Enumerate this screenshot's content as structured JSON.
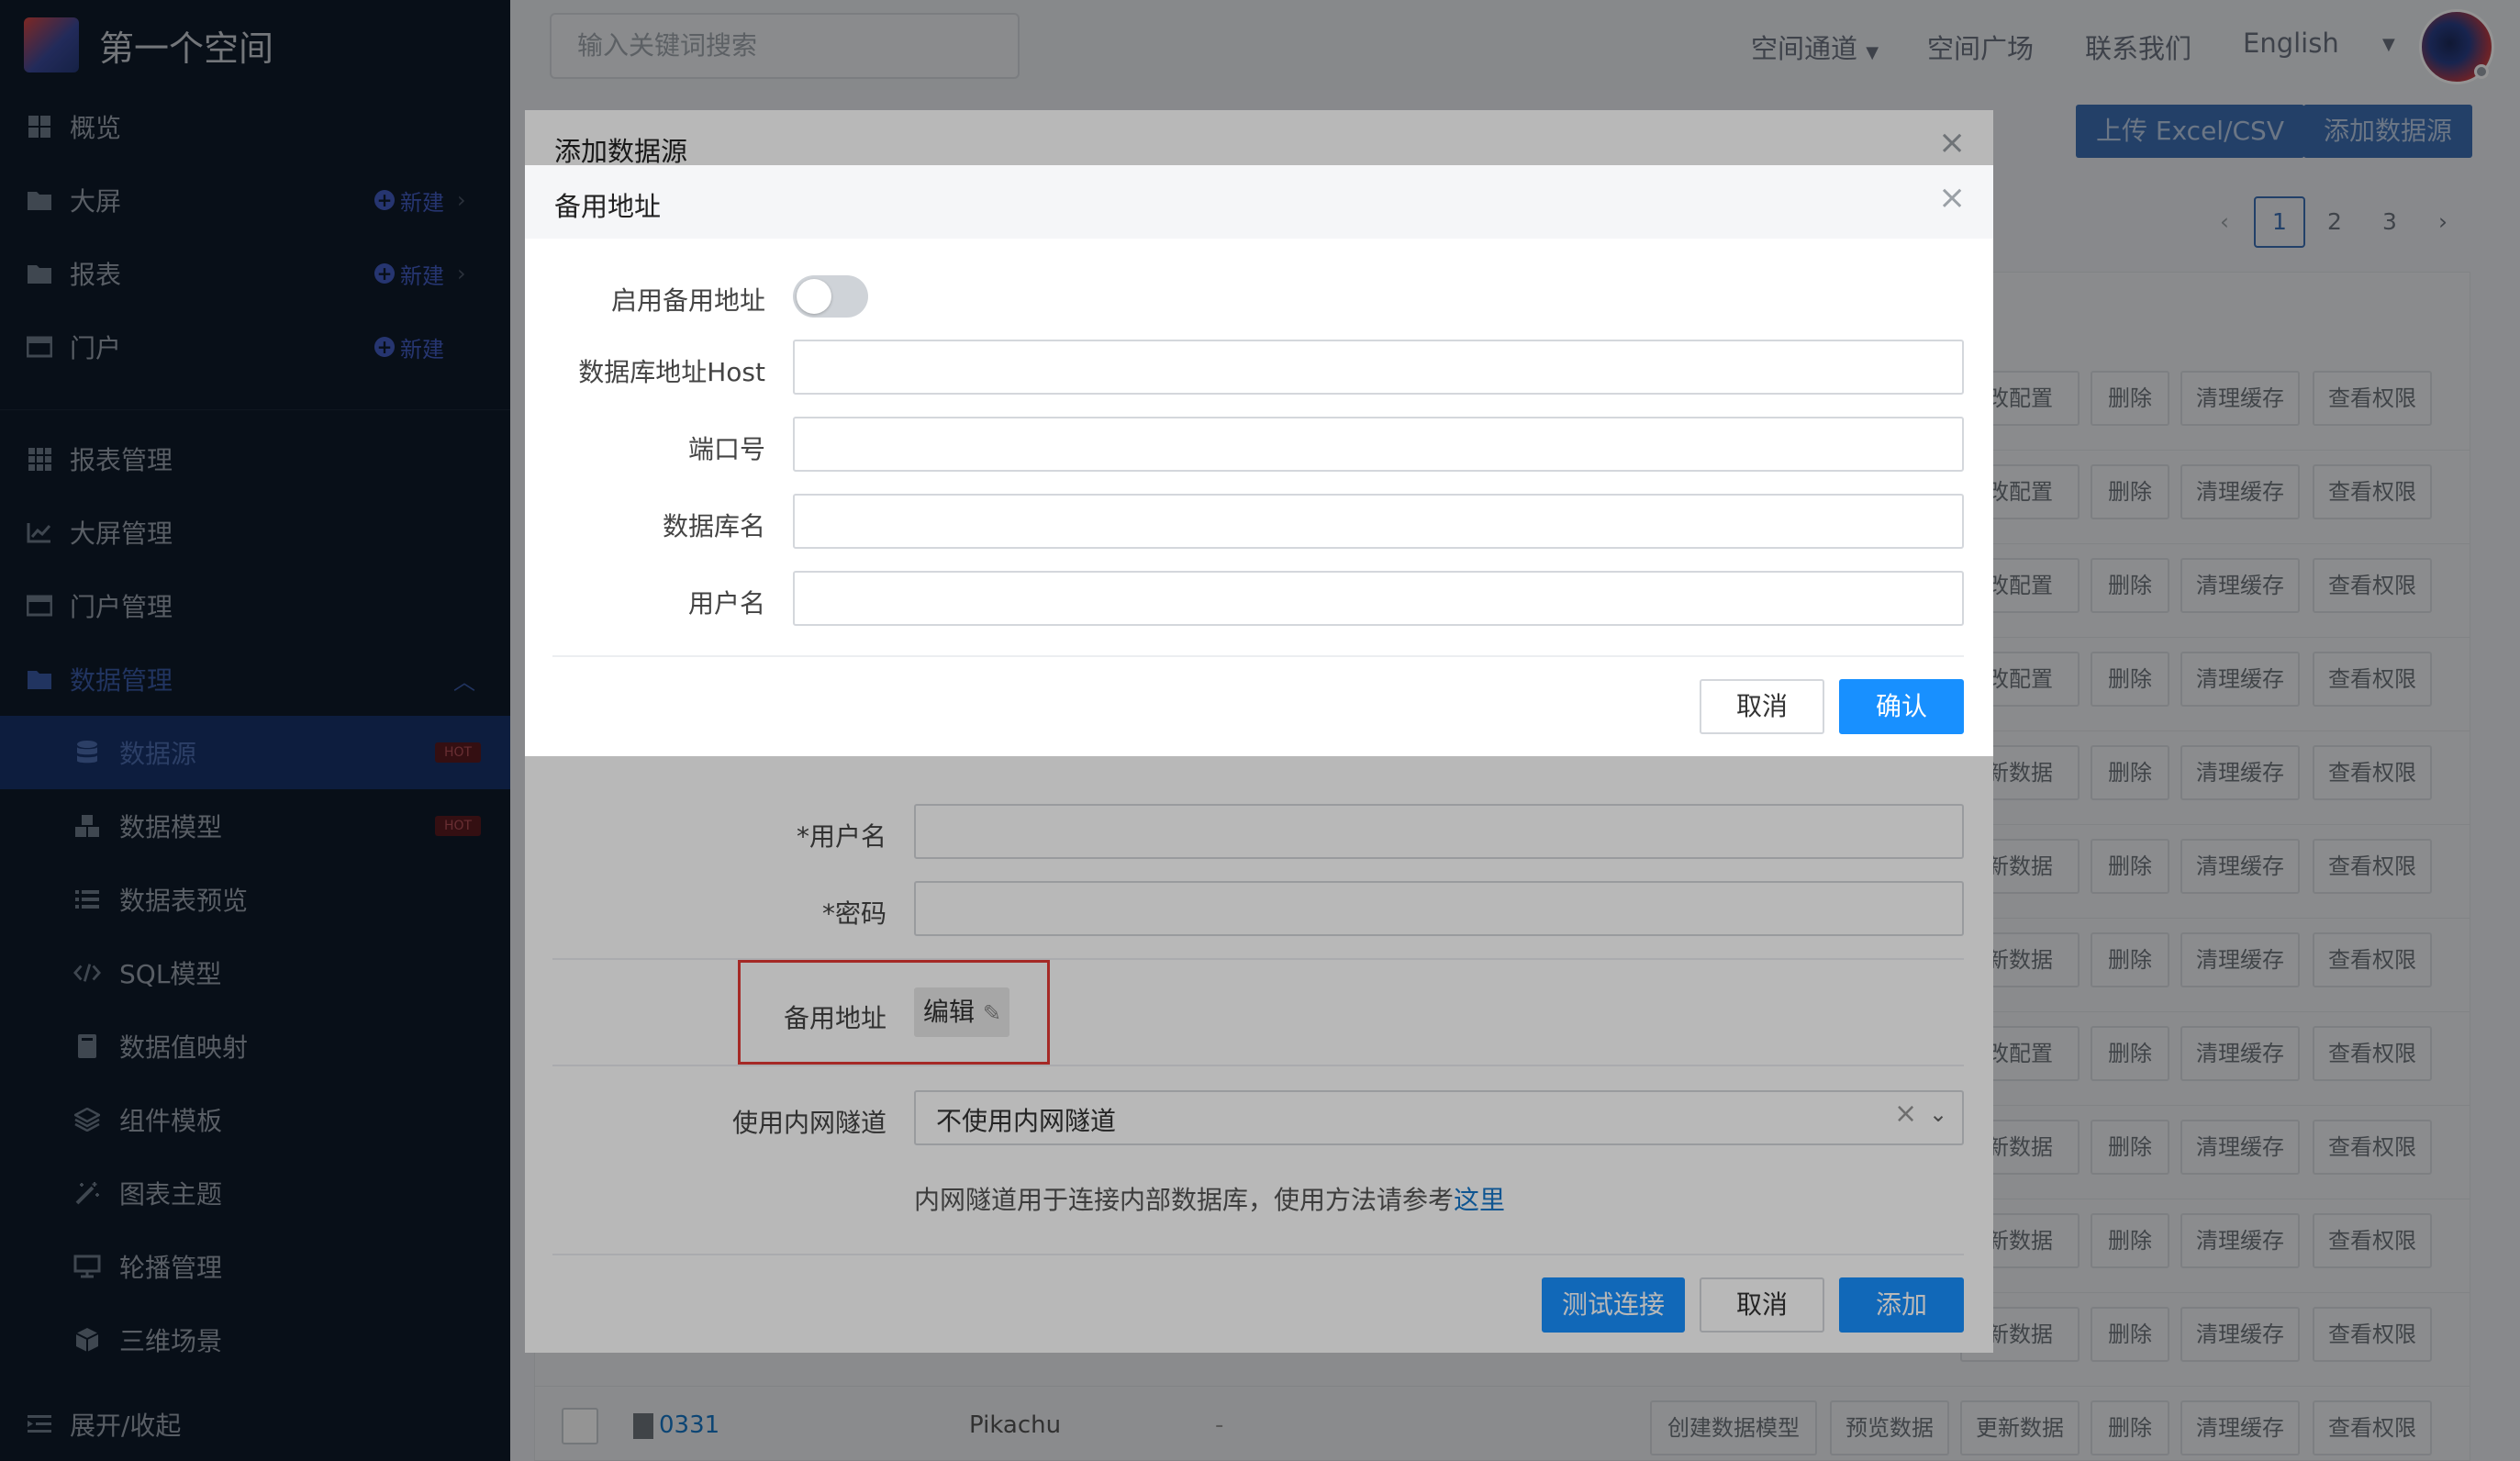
{
  "sidebar": {
    "space_name": "第一个空间",
    "new_label": "新建",
    "hot_label": "HOT",
    "items": [
      {
        "label": "概览",
        "icon": "grid-icon"
      },
      {
        "label": "大屏",
        "icon": "folder-icon"
      },
      {
        "label": "报表",
        "icon": "folder-icon"
      },
      {
        "label": "门户",
        "icon": "window-icon"
      },
      {
        "label": "报表管理",
        "icon": "apps-icon"
      },
      {
        "label": "大屏管理",
        "icon": "chart-line-icon"
      },
      {
        "label": "门户管理",
        "icon": "window-icon"
      },
      {
        "label": "数据管理",
        "icon": "folder-icon"
      },
      {
        "label": "数据源",
        "icon": "database-icon"
      },
      {
        "label": "数据模型",
        "icon": "cubes-icon"
      },
      {
        "label": "数据表预览",
        "icon": "list-icon"
      },
      {
        "label": "SQL模型",
        "icon": "code-icon"
      },
      {
        "label": "数据值映射",
        "icon": "book-icon"
      },
      {
        "label": "组件模板",
        "icon": "component-icon"
      },
      {
        "label": "图表主题",
        "icon": "magic-wand-icon"
      },
      {
        "label": "轮播管理",
        "icon": "monitor-icon"
      },
      {
        "label": "三维场景",
        "icon": "cube-icon"
      }
    ],
    "collapse_label": "展开/收起"
  },
  "topbar": {
    "search_placeholder": "输入关键词搜索",
    "links": [
      "空间通道",
      "空间广场",
      "联系我们",
      "English"
    ]
  },
  "page": {
    "upload_button": "上传 Excel/CSV",
    "add_button": "添加数据源",
    "pagination": [
      "1",
      "2",
      "3"
    ],
    "current_page": "1",
    "row_actions": {
      "edit_config": "修改配置",
      "update_data": "更新数据",
      "delete": "删除",
      "clear_cache": "清理缓存",
      "view_permission": "查看权限",
      "create_model": "创建数据模型",
      "preview_data": "预览数据",
      "partial_edit": "改配置",
      "partial_update": "新数据"
    },
    "last_row": {
      "name": "0331",
      "creator": "Pikachu",
      "dash": "-"
    }
  },
  "outer_dialog": {
    "title": "添加数据源",
    "username_label": "*用户名",
    "password_label": "*密码",
    "backup_label": "备用地址",
    "edit_label": "编辑",
    "tunnel_label": "使用内网隧道",
    "tunnel_value": "不使用内网隧道",
    "hint_text": "内网隧道用于连接内部数据库，使用方法请参考",
    "hint_link": "这里",
    "test_button": "测试连接",
    "cancel_button": "取消",
    "add_button": "添加"
  },
  "inner_dialog": {
    "title": "备用地址",
    "enable_label": "启用备用地址",
    "enabled": false,
    "host_label": "数据库地址Host",
    "port_label": "端口号",
    "db_label": "数据库名",
    "user_label": "用户名",
    "cancel_button": "取消",
    "confirm_button": "确认"
  },
  "colors": {
    "primary": "#1890ff",
    "sidebar_bg": "#0e1a2a",
    "highlight_box": "#e53935",
    "link": "#1677c9"
  }
}
